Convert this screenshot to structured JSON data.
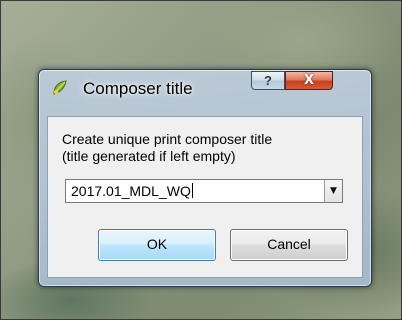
{
  "dialog": {
    "title": "Composer title",
    "help_label": "?",
    "close_label": "X",
    "app_icon": "qgis-icon"
  },
  "form": {
    "prompt": "Create unique print composer title\n(title generated if left empty)",
    "title_value": "2017.01_MDL_WQ",
    "dropdown_icon": "chevron-down-icon"
  },
  "buttons": {
    "ok_label": "OK",
    "cancel_label": "Cancel"
  },
  "colors": {
    "ok_border": "#3c7fb1",
    "close_button": "#c7421f"
  }
}
